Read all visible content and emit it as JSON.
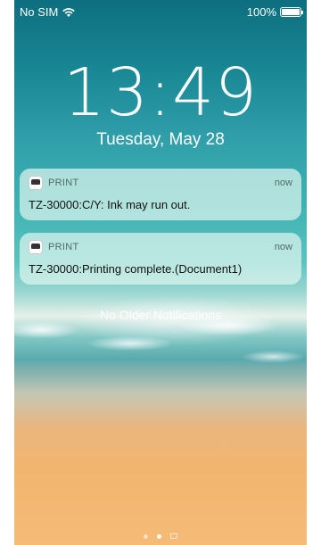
{
  "status_bar": {
    "carrier": "No SIM",
    "battery": "100%",
    "icons": [
      "wifi-icon",
      "battery-icon"
    ]
  },
  "lock_screen": {
    "time": "13:49",
    "date": "Tuesday, May 28"
  },
  "notifications": [
    {
      "app": "PRINT",
      "time": "now",
      "message": "TZ-30000:C/Y: Ink may run out.",
      "icon": "printer-app-icon"
    },
    {
      "app": "PRINT",
      "time": "now",
      "message": "TZ-30000:Printing complete.(Document1)",
      "icon": "printer-app-icon"
    }
  ],
  "no_older_label": "No Older Notifications",
  "pager": {
    "count": 3,
    "active_index": 1,
    "icons": [
      "dot",
      "dot",
      "camera-icon"
    ]
  }
}
